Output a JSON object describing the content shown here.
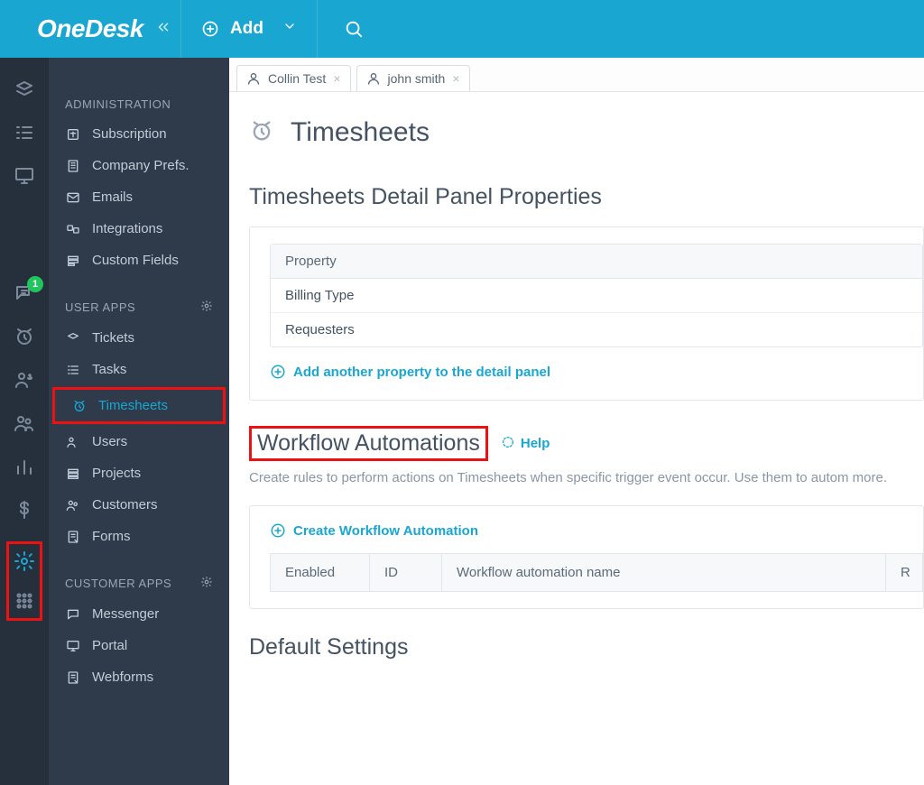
{
  "topbar": {
    "logo": "OneDesk",
    "add_label": "Add"
  },
  "rail": {
    "chat_badge": "1"
  },
  "sidebar": {
    "section_admin": "ADMINISTRATION",
    "admin_items": [
      {
        "label": "Subscription"
      },
      {
        "label": "Company Prefs."
      },
      {
        "label": "Emails"
      },
      {
        "label": "Integrations"
      },
      {
        "label": "Custom Fields"
      }
    ],
    "section_user_apps": "USER APPS",
    "user_app_items": [
      {
        "label": "Tickets"
      },
      {
        "label": "Tasks"
      },
      {
        "label": "Timesheets"
      },
      {
        "label": "Users"
      },
      {
        "label": "Projects"
      },
      {
        "label": "Customers"
      },
      {
        "label": "Forms"
      }
    ],
    "section_customer_apps": "CUSTOMER APPS",
    "customer_app_items": [
      {
        "label": "Messenger"
      },
      {
        "label": "Portal"
      },
      {
        "label": "Webforms"
      }
    ]
  },
  "tabs": [
    {
      "label": "Collin Test"
    },
    {
      "label": "john smith"
    }
  ],
  "page": {
    "title": "Timesheets",
    "detail_section_title": "Timesheets Detail Panel Properties",
    "property_header": "Property",
    "properties": [
      "Billing Type",
      "Requesters"
    ],
    "add_property_link": "Add another property to the detail panel",
    "workflow_title": "Workflow Automations",
    "help_label": "Help",
    "workflow_subtext": "Create rules to perform actions on Timesheets when specific trigger event occur. Use them to autom more.",
    "create_workflow_link": "Create Workflow Automation",
    "wf_col_enabled": "Enabled",
    "wf_col_id": "ID",
    "wf_col_name": "Workflow automation name",
    "wf_col_r": "R",
    "default_settings_title": "Default Settings"
  }
}
